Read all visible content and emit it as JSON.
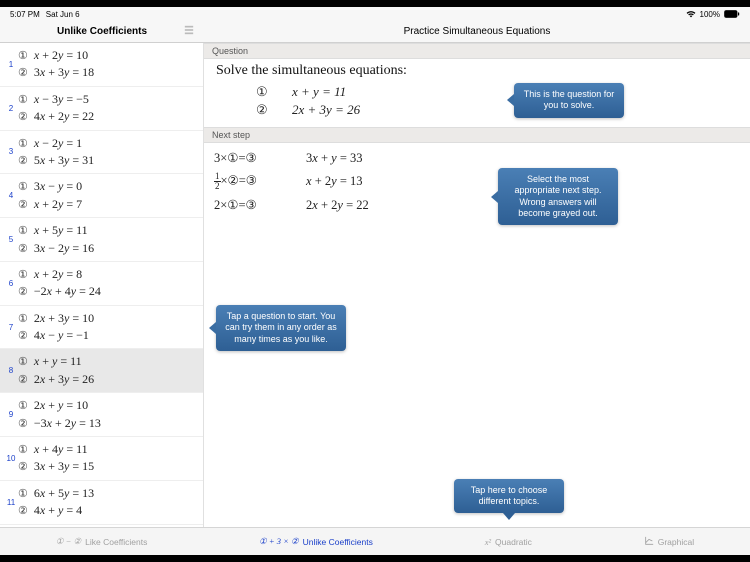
{
  "statusbar": {
    "time": "5:07 PM",
    "date": "Sat Jun 6",
    "battery_pct": "100%"
  },
  "titlebar": {
    "side": "Unlike Coefficients",
    "main": "Practice Simultaneous Equations"
  },
  "sidebar_items": [
    {
      "n": "1",
      "a": "x + 2y = 10",
      "b": "3x + 3y = 18"
    },
    {
      "n": "2",
      "a": "x − 3y = −5",
      "b": "4x + 2y = 22"
    },
    {
      "n": "3",
      "a": "x − 2y = 1",
      "b": "5x + 3y = 31"
    },
    {
      "n": "4",
      "a": "3x − y = 0",
      "b": "x + 2y = 7"
    },
    {
      "n": "5",
      "a": "x + 5y = 11",
      "b": "3x − 2y = 16"
    },
    {
      "n": "6",
      "a": "x + 2y = 8",
      "b": "−2x + 4y = 24"
    },
    {
      "n": "7",
      "a": "2x + 3y = 10",
      "b": "4x − y = −1"
    },
    {
      "n": "8",
      "a": "x + y = 11",
      "b": "2x + 3y = 26",
      "selected": true
    },
    {
      "n": "9",
      "a": "2x + y = 10",
      "b": "−3x + 2y = 13"
    },
    {
      "n": "10",
      "a": "x + 4y = 11",
      "b": "3x + 3y = 15"
    },
    {
      "n": "11",
      "a": "6x + 5y = 13",
      "b": "4x + y = 4"
    }
  ],
  "circled": {
    "one": "①",
    "two": "②",
    "three": "③"
  },
  "main": {
    "section_q": "Question",
    "prompt": "Solve the simultaneous equations:",
    "eq1": "x + y = 11",
    "eq2": "2x + 3y = 26",
    "section_ns": "Next step",
    "steps": [
      {
        "lhs_pre": "3×",
        "lhs_circ": "①",
        "lhs_eq": "=③",
        "rhs": "3x + y = 33"
      },
      {
        "lhs_frac": true,
        "lhs_pre": "½×",
        "lhs_circ": "②",
        "lhs_eq": "=③",
        "rhs": "x + 2y = 13"
      },
      {
        "lhs_pre": "2×",
        "lhs_circ": "①",
        "lhs_eq": "=③",
        "rhs": "2x + 2y = 22"
      }
    ]
  },
  "callouts": {
    "q": "This is the question for you to solve.",
    "ns": "Select the most appropriate next step. Wrong answers will become grayed out.",
    "side": "Tap a question to start. You can try them in any order as many times as you like.",
    "tabs": "Tap here to choose different topics."
  },
  "tabs": {
    "like": "Like Coefficients",
    "unlike": "Unlike Coefficients",
    "quad": "Quadratic",
    "graph": "Graphical",
    "like_icon": "① − ②",
    "unlike_icon": "① + 3 × ②",
    "quad_icon": "x²",
    "graph_icon": "⍂"
  }
}
